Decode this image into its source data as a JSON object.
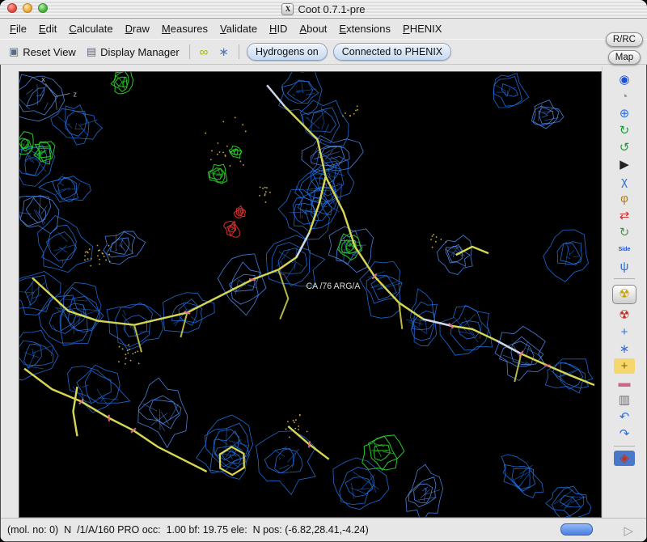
{
  "window": {
    "title": "Coot 0.7.1-pre",
    "app_icon": "X"
  },
  "menubar": {
    "items": [
      "File",
      "Edit",
      "Calculate",
      "Draw",
      "Measures",
      "Validate",
      "HID",
      "About",
      "Extensions",
      "PHENIX"
    ]
  },
  "toolbar": {
    "reset_icon": "▣",
    "reset_view": "Reset View",
    "display_icon": "▤",
    "display_manager": "Display Manager",
    "ligand_icon": "∞",
    "builder_icon": "∗",
    "hydrogens_toggle": "Hydrogens on",
    "phenix_toggle": "Connected to PHENIX"
  },
  "corner_buttons": {
    "rrc": "R/RC",
    "map": "Map"
  },
  "right_toolbar": {
    "icons": [
      {
        "name": "recenter-view-icon",
        "glyph": "◉",
        "color": "#1c4fd8"
      },
      {
        "name": "clock-icon",
        "glyph": "◔",
        "color": "#909090"
      },
      {
        "name": "move-zone-icon",
        "glyph": "⊕",
        "color": "#2b6fe0"
      },
      {
        "name": "rotate-zone-icon",
        "glyph": "↻",
        "color": "#1f9a3c"
      },
      {
        "name": "spin-view-icon",
        "glyph": "↺",
        "color": "#1f9a3c"
      },
      {
        "name": "play-icon",
        "glyph": "▶",
        "color": "#222222"
      },
      {
        "name": "chi-angles-icon",
        "glyph": "χ",
        "color": "#2b6fe0"
      },
      {
        "name": "torsion-general-icon",
        "glyph": "φ",
        "color": "#b08020"
      },
      {
        "name": "flip-peptide-icon",
        "glyph": "⇄",
        "color": "#cc3333"
      },
      {
        "name": "cycle-conformer-icon",
        "glyph": "↻",
        "color": "#5a8a5a"
      },
      {
        "name": "side-chain-flip-icon",
        "glyph": "Side",
        "color": "#1c4fd8",
        "small": true
      },
      {
        "name": "backbone-icon",
        "glyph": "ψ",
        "color": "#2b6fe0"
      },
      {
        "sep": true
      },
      {
        "name": "refine-zone-icon",
        "glyph": "☢",
        "color": "#c8a000",
        "selected": true
      },
      {
        "name": "regularize-zone-icon",
        "glyph": "☢",
        "color": "#c03020"
      },
      {
        "name": "add-atom-icon",
        "glyph": "+",
        "color": "#2b6fe0"
      },
      {
        "name": "auto-fit-icon",
        "glyph": "∗",
        "color": "#3a6fd0"
      },
      {
        "name": "add-residue-icon",
        "glyph": "+",
        "color": "#806000",
        "bg": "#f5d76e"
      },
      {
        "name": "alt-conf-icon",
        "glyph": "▬",
        "color": "#cc6688"
      },
      {
        "name": "delete-atom-icon",
        "glyph": "▥",
        "color": "#6e6e6e"
      },
      {
        "name": "undo-icon",
        "glyph": "↶",
        "color": "#2b6fe0"
      },
      {
        "name": "redo-icon",
        "glyph": "↷",
        "color": "#2b6fe0"
      },
      {
        "sep": true
      },
      {
        "name": "run-refmac-icon",
        "glyph": "◈",
        "color": "#c03020",
        "bg": "#4a78c8"
      }
    ]
  },
  "canvas": {
    "residue_label": "CA /76 ARG/A",
    "axis_labels": {
      "x": "x",
      "z": "z"
    }
  },
  "statusbar": {
    "text": "(mol. no: 0)  N  /1/A/160 PRO occ:  1.00 bf: 19.75 ele:  N pos: (-6.82,28.41,-4.24)"
  },
  "colors": {
    "density": "#2273e8",
    "density_light": "#4f8df2",
    "difference_pos": "#29c829",
    "difference_neg": "#e03030",
    "sticks": "#d6d654",
    "sticks_dark": "#b6b646",
    "accent_sticks": "#ccd6ea",
    "ticks": "#e86a8a",
    "dots": "#c8a83a",
    "axes": "#7d8fa6"
  }
}
